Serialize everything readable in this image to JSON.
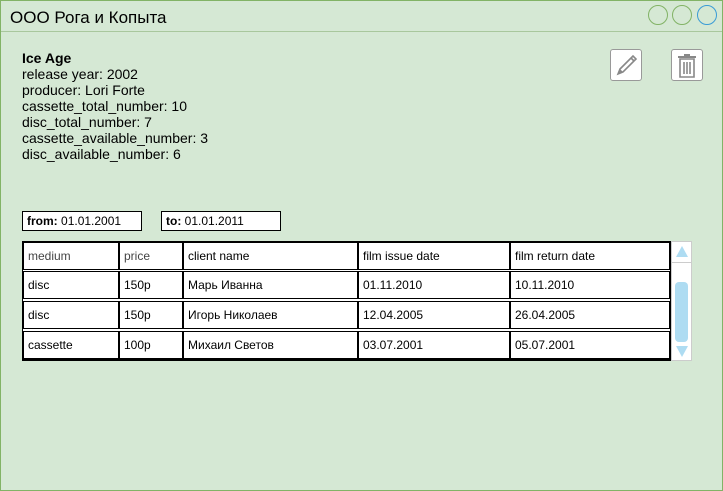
{
  "window": {
    "title": "ООО Рога и Копыта"
  },
  "film": {
    "title": "Ice Age",
    "release_year": "release year: 2002",
    "producer": "producer: Lori Forte",
    "cassette_total": "cassette_total_number: 10",
    "disc_total": "disc_total_number: 7",
    "cassette_available": "cassette_available_number: 3",
    "disc_available": "disc_available_number: 6"
  },
  "actions": {
    "edit_icon": "pencil-icon",
    "delete_icon": "trash-icon"
  },
  "filter": {
    "from_label": "from:",
    "from_value": "01.01.2001",
    "to_label": "to:",
    "to_value": "01.01.2011"
  },
  "table": {
    "columns": [
      "medium",
      "price",
      "client name",
      "film issue date",
      "film return date"
    ],
    "rows": [
      [
        "disc",
        "150р",
        "Марь Иванна",
        "01.11.2010",
        "10.11.2010"
      ],
      [
        "disc",
        "150р",
        "Игорь Николаев",
        "12.04.2005",
        "26.04.2005"
      ],
      [
        "cassette",
        "100р",
        "Михаил Светов",
        "03.07.2001",
        "05.07.2001"
      ]
    ]
  },
  "colors": {
    "window_bg": "#d5e8d4",
    "window_border": "#82b366",
    "accent_blue": "#3a9cd6",
    "scroll_blue": "#aedcf2"
  }
}
